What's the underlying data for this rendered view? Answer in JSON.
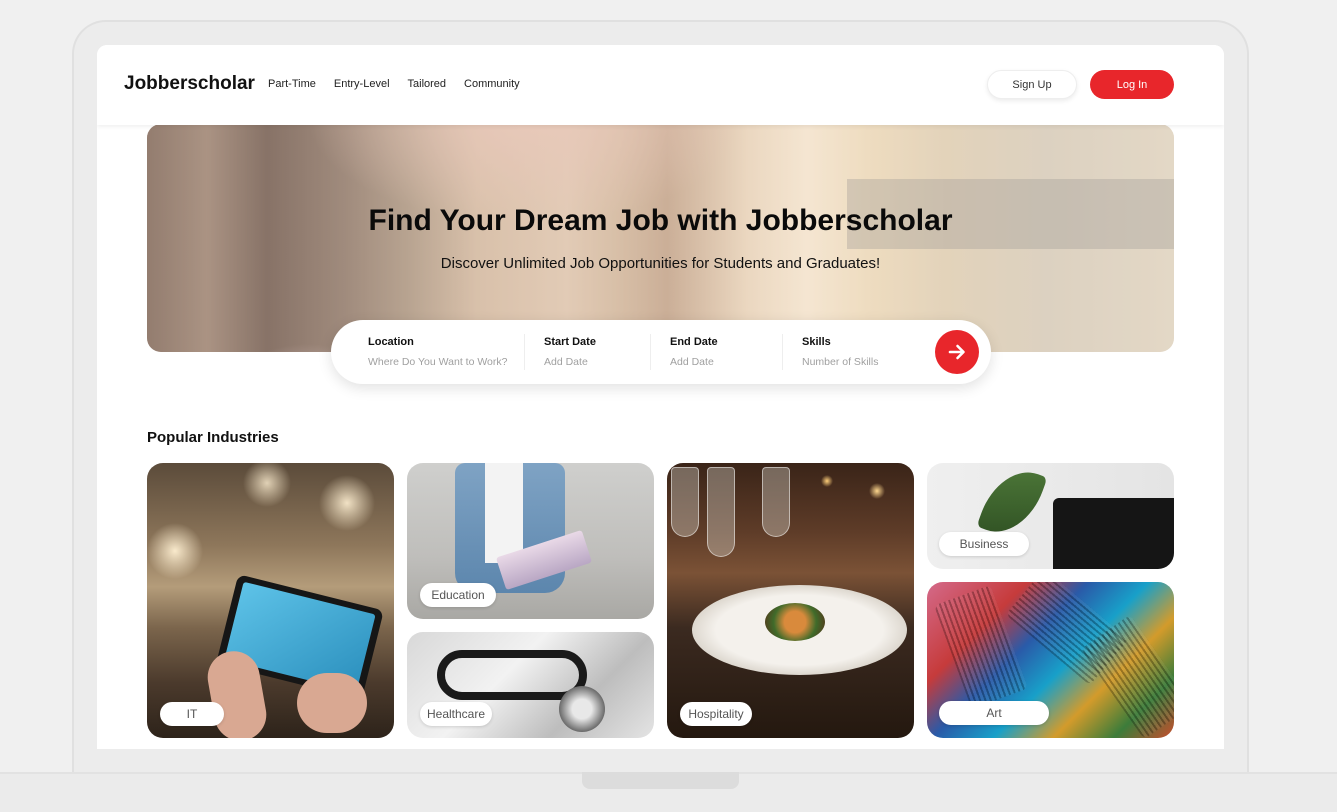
{
  "brand": "Jobberscholar",
  "nav": {
    "links": [
      "Part-Time",
      "Entry-Level",
      "Tailored",
      "Community"
    ],
    "signup_label": "Sign Up",
    "login_label": "Log In"
  },
  "hero": {
    "title": "Find Your Dream Job with Jobberscholar",
    "subtitle": "Discover Unlimited Job Opportunities for Students and Graduates!"
  },
  "search": {
    "location": {
      "label": "Location",
      "placeholder": "Where Do You Want to Work?"
    },
    "start_date": {
      "label": "Start Date",
      "placeholder": "Add Date"
    },
    "end_date": {
      "label": "End Date",
      "placeholder": "Add Date"
    },
    "skills": {
      "label": "Skills",
      "placeholder": "Number of Skills"
    },
    "submit_icon": "arrow-right-icon"
  },
  "industries": {
    "title": "Popular Industries",
    "items": [
      "IT",
      "Education",
      "Healthcare",
      "Hospitality",
      "Business",
      "Art"
    ]
  },
  "colors": {
    "accent": "#e8262b",
    "background": "#f0f0f0",
    "surface": "#ffffff"
  }
}
